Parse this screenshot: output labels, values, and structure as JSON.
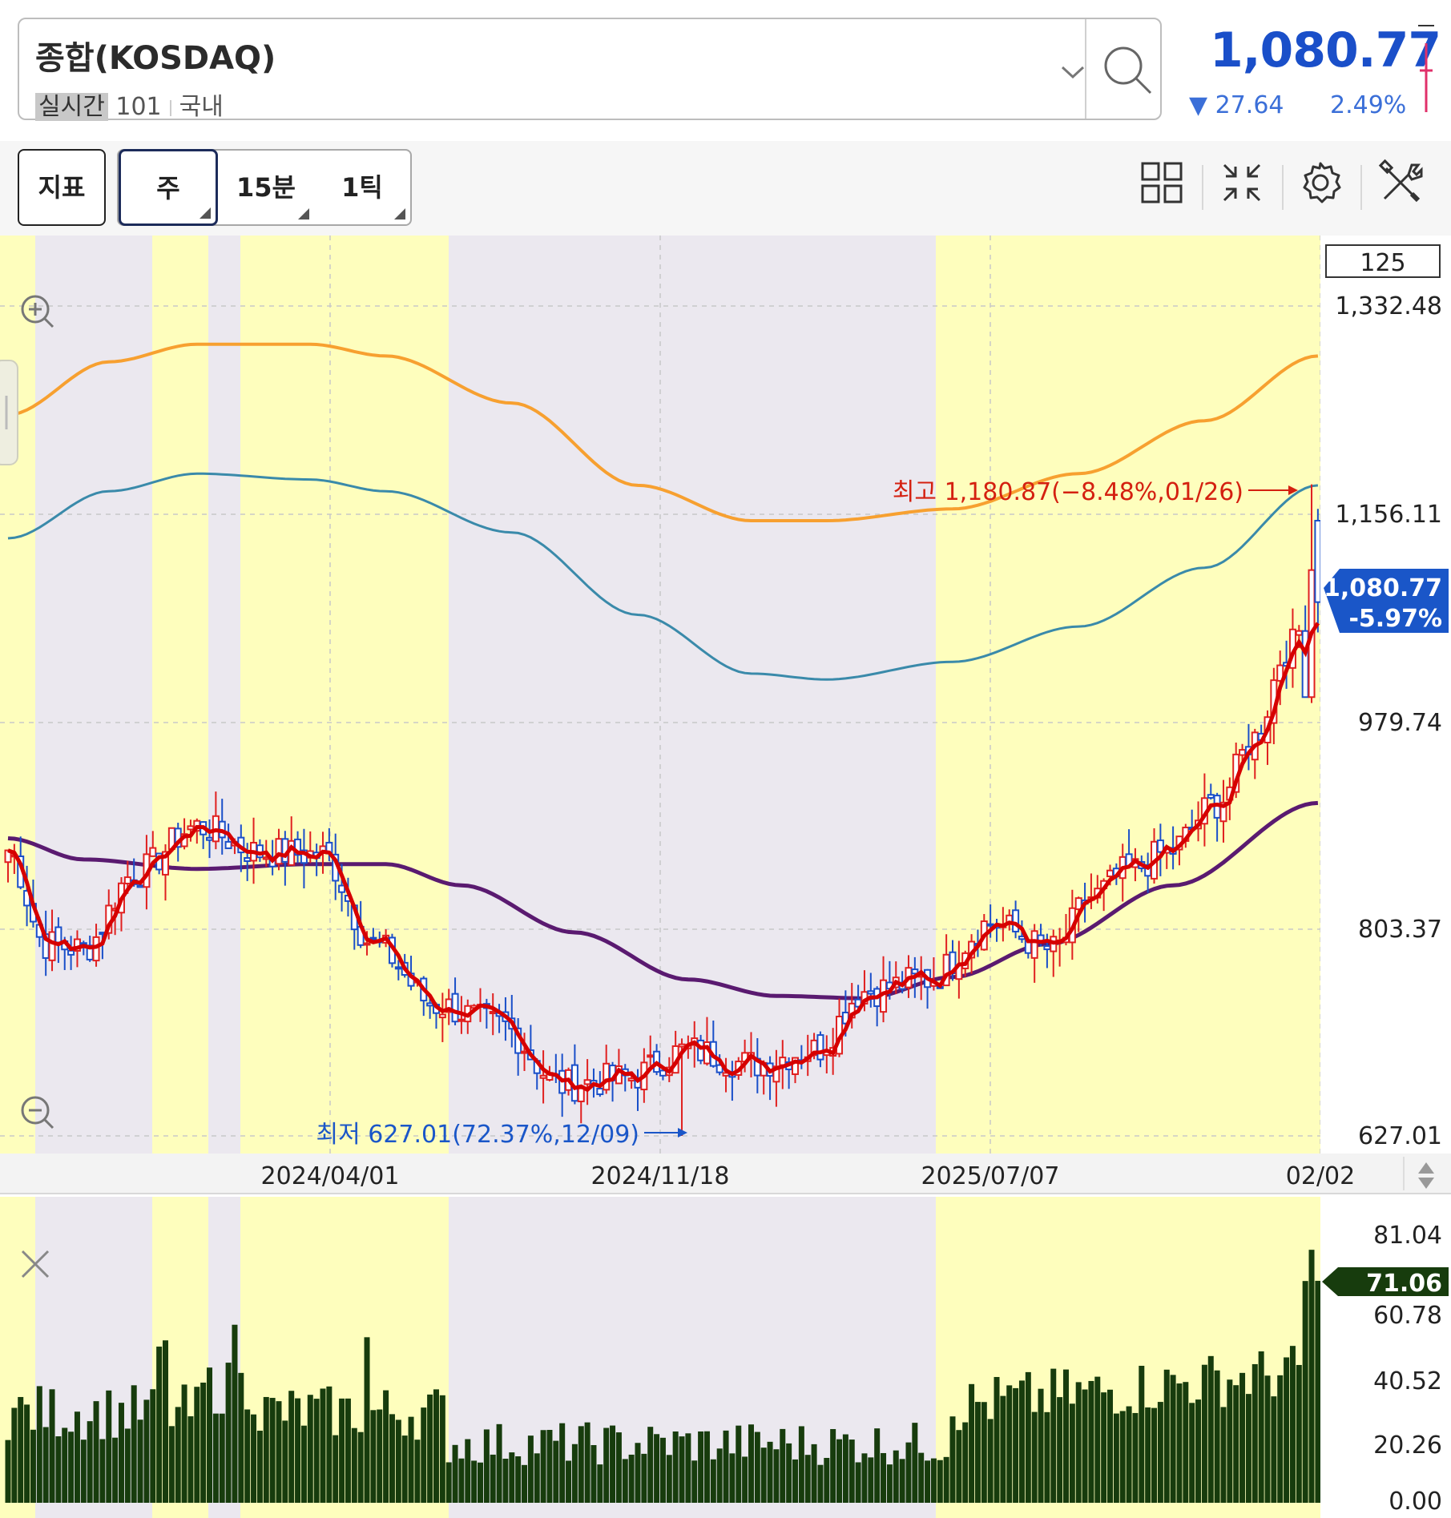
{
  "header": {
    "symbol_name": "종합(KOSDAQ)",
    "realtime_badge": "실시간",
    "code": "101",
    "market": "국내",
    "price": "1,080.77",
    "change": "▼ 27.64",
    "change_pct": "2.49%"
  },
  "toolbar": {
    "indicator_label": "지표",
    "period_week": "주",
    "period_15m": "15분",
    "period_1tick": "1틱"
  },
  "colors": {
    "down_blue": "#1a4fc9",
    "up_red": "#e02020",
    "ma_short": "#d60000",
    "ma_long": "#5a1a70",
    "band_upper": "#f7a030",
    "band_mid": "#3a8aaa",
    "volume_bar": "#173c0d",
    "highlight_yellow": "#fefebd",
    "shade_gray": "#ebe8ef"
  },
  "chart_data": [
    {
      "type": "candlestick",
      "name": "price",
      "count_box": "125",
      "y_ticks": [
        "1,332.48",
        "1,156.11",
        "979.74",
        "803.37",
        "627.01"
      ],
      "y_range": [
        627.01,
        1332.48
      ],
      "x_ticks": [
        "2024/04/01",
        "2024/11/18",
        "2025/07/07",
        "02/02"
      ],
      "current_label_price": "1,080.77",
      "current_label_pct": "-5.97%",
      "max_annotation": "최고 1,180.87(−8.48%,01/26)",
      "min_annotation": "최저 627.01(72.37%,12/09)",
      "close_anchors": [
        [
          0,
          870
        ],
        [
          6,
          790
        ],
        [
          12,
          786
        ],
        [
          20,
          850
        ],
        [
          30,
          890
        ],
        [
          40,
          868
        ],
        [
          50,
          866
        ],
        [
          58,
          790
        ],
        [
          68,
          738
        ],
        [
          78,
          722
        ],
        [
          88,
          670
        ],
        [
          98,
          676
        ],
        [
          108,
          700
        ],
        [
          118,
          688
        ],
        [
          128,
          700
        ],
        [
          136,
          750
        ],
        [
          146,
          760
        ],
        [
          156,
          808
        ],
        [
          166,
          785
        ],
        [
          172,
          830
        ],
        [
          178,
          852
        ],
        [
          184,
          868
        ],
        [
          192,
          910
        ],
        [
          198,
          965
        ],
        [
          203,
          1040
        ],
        [
          208,
          1085
        ]
      ],
      "upper_band_anchors": [
        [
          0,
          1240
        ],
        [
          16,
          1285
        ],
        [
          30,
          1300
        ],
        [
          48,
          1300
        ],
        [
          60,
          1290
        ],
        [
          80,
          1250
        ],
        [
          100,
          1180
        ],
        [
          118,
          1150
        ],
        [
          130,
          1150
        ],
        [
          150,
          1160
        ],
        [
          170,
          1190
        ],
        [
          190,
          1235
        ],
        [
          208,
          1290
        ]
      ],
      "mid_band_anchors": [
        [
          0,
          1135
        ],
        [
          16,
          1175
        ],
        [
          30,
          1190
        ],
        [
          48,
          1185
        ],
        [
          60,
          1175
        ],
        [
          80,
          1140
        ],
        [
          100,
          1070
        ],
        [
          118,
          1020
        ],
        [
          130,
          1015
        ],
        [
          150,
          1030
        ],
        [
          170,
          1060
        ],
        [
          190,
          1110
        ],
        [
          208,
          1180
        ]
      ],
      "long_ma_anchors": [
        [
          0,
          880
        ],
        [
          12,
          862
        ],
        [
          30,
          854
        ],
        [
          48,
          858
        ],
        [
          60,
          858
        ],
        [
          72,
          840
        ],
        [
          90,
          800
        ],
        [
          108,
          760
        ],
        [
          122,
          746
        ],
        [
          136,
          744
        ],
        [
          150,
          762
        ],
        [
          165,
          790
        ],
        [
          185,
          840
        ],
        [
          208,
          910
        ]
      ]
    },
    {
      "type": "bar",
      "name": "volume",
      "y_ticks": [
        "81.04",
        "71.06",
        "60.78",
        "40.52",
        "20.26",
        "0.00"
      ],
      "y_range": [
        0,
        81.04
      ],
      "current_value": "71.06"
    }
  ]
}
